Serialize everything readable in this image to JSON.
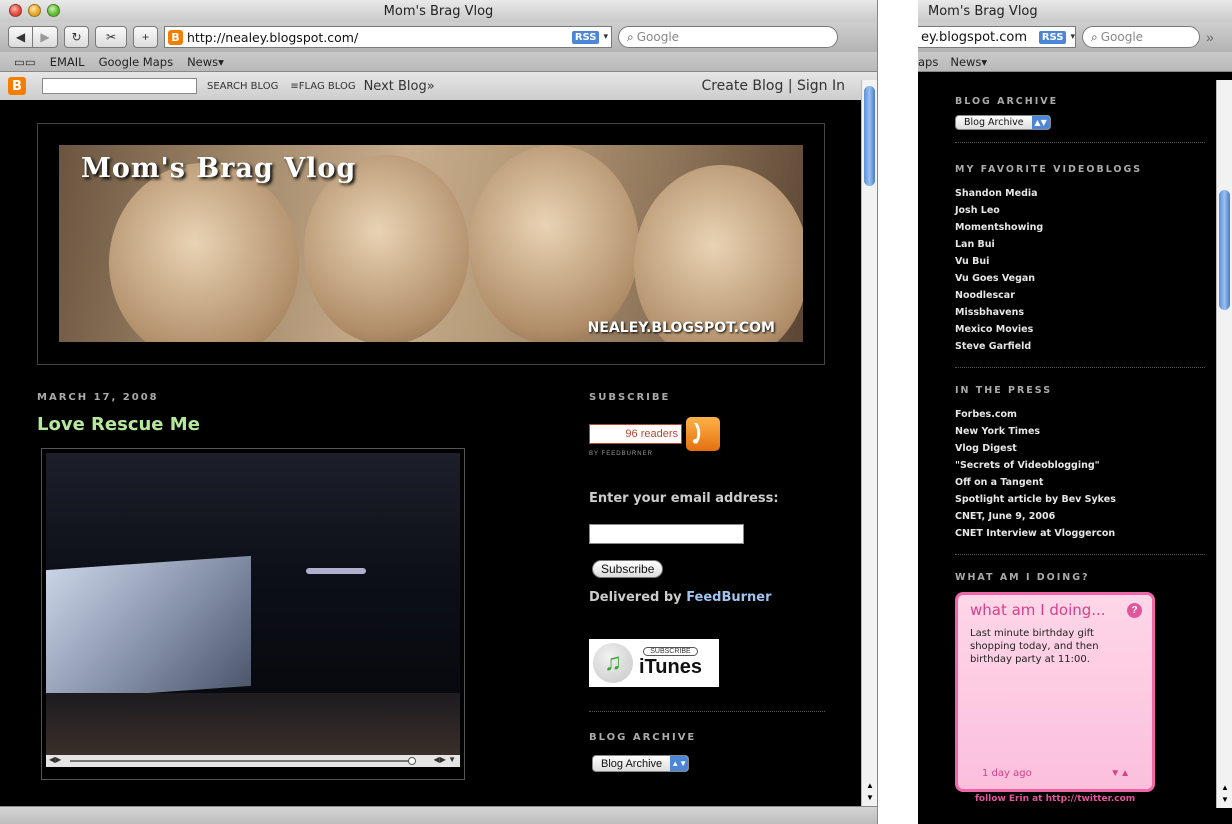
{
  "window1": {
    "title": "Mom's Brag Vlog",
    "url": "http://nealey.blogspot.com/",
    "rss": "RSS",
    "search_placeholder": "Google",
    "bookmarks": [
      "EMAIL",
      "Google Maps",
      "News"
    ],
    "navbar": {
      "search_blog": "SEARCH BLOG",
      "flag_blog": "FLAG BLOG",
      "next_blog": "Next Blog»",
      "create_blog": "Create Blog",
      "separator": "|",
      "sign_in": "Sign In"
    },
    "banner": {
      "title": "Mom's Brag Vlog",
      "url_text": "NEALEY.BLOGSPOT.COM"
    },
    "post": {
      "date": "MARCH 17, 2008",
      "title": "Love Rescue Me"
    },
    "sidebar": {
      "subscribe_heading": "SUBSCRIBE",
      "readers": "96 readers",
      "by_feedburner": "BY FEEDBURNER",
      "email_label": "Enter your email address:",
      "subscribe_button": "Subscribe",
      "delivered_by": "Delivered by",
      "feedburner": "FeedBurner",
      "itunes_subscribe": "SUBSCRIBE",
      "itunes": "iTunes",
      "archive_heading": "BLOG ARCHIVE",
      "archive_select": "Blog Archive"
    }
  },
  "window2": {
    "title": "Mom's Brag Vlog",
    "url": "ey.blogspot.com",
    "rss": "RSS",
    "search_placeholder": "Google",
    "bookmarks": [
      "aps",
      "News"
    ],
    "archive_heading": "BLOG ARCHIVE",
    "archive_select": "Blog Archive",
    "videoblogs_heading": "MY FAVORITE VIDEOBLOGS",
    "videoblogs": [
      "Shandon Media",
      "Josh Leo",
      "Momentshowing",
      "Lan Bui",
      "Vu Bui",
      "Vu Goes Vegan",
      "Noodlescar",
      "Missbhavens",
      "Mexico Movies",
      "Steve Garfield"
    ],
    "press_heading": "IN THE PRESS",
    "press": [
      "Forbes.com",
      "New York Times",
      "Vlog Digest",
      "\"Secrets of Videoblogging\"",
      "Off on a Tangent",
      "Spotlight article by Bev Sykes",
      "CNET, June 9, 2006",
      "CNET Interview at Vloggercon"
    ],
    "doing_heading": "WHAT AM I DOING?",
    "twitter": {
      "title": "what am I doing...",
      "body": "Last minute birthday gift shopping today, and then birthday party at 11:00.",
      "time": "1 day ago",
      "follow": "follow Erin at http://twitter.com"
    }
  }
}
